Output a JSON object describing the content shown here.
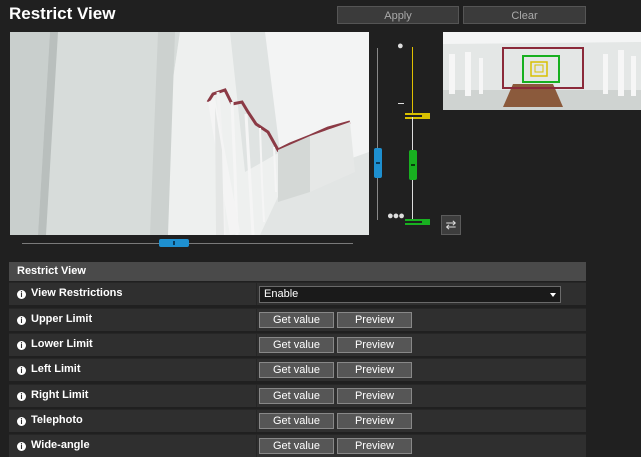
{
  "page": {
    "title": "Restrict View"
  },
  "toolbar": {
    "apply_label": "Apply",
    "clear_label": "Clear"
  },
  "controls": {
    "pan_slider": {
      "value_fraction": 0.46
    },
    "zoom_slider": {
      "value_fraction": 0.6
    },
    "tilt_slider": {
      "value_fraction": 0.67,
      "upper_limit_color": "#d8c000",
      "lower_limit_color": "#18b020"
    },
    "swap_icon": "swap-arrows-icon",
    "zoom_in_icon": "single-drop-icon",
    "zoom_out_icon": "triple-drop-icon"
  },
  "colors": {
    "accent_blue": "#1e90d0",
    "tilt_green": "#18b020",
    "tilt_yellow": "#d8c000",
    "overview_frame": "#8b2a3a"
  },
  "settings": {
    "header": "Restrict View",
    "rows": [
      {
        "label": "View Restrictions",
        "type": "select",
        "value": "Enable"
      },
      {
        "label": "Upper Limit",
        "type": "buttons",
        "get": "Get value",
        "preview": "Preview"
      },
      {
        "label": "Lower Limit",
        "type": "buttons",
        "get": "Get value",
        "preview": "Preview"
      },
      {
        "label": "Left Limit",
        "type": "buttons",
        "get": "Get value",
        "preview": "Preview"
      },
      {
        "label": "Right Limit",
        "type": "buttons",
        "get": "Get value",
        "preview": "Preview"
      },
      {
        "label": "Telephoto",
        "type": "buttons",
        "get": "Get value",
        "preview": "Preview"
      },
      {
        "label": "Wide-angle",
        "type": "buttons",
        "get": "Get value",
        "preview": "Preview"
      }
    ]
  }
}
